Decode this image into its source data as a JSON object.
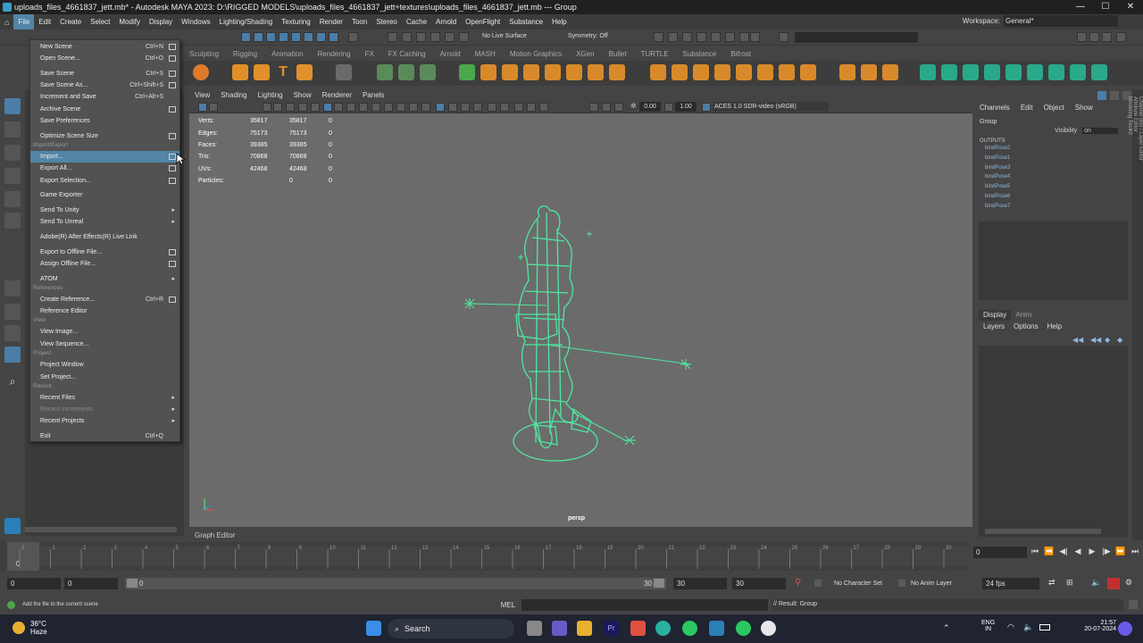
{
  "window": {
    "title": "uploads_files_4661837_jett.mb* - Autodesk MAYA 2023: D:\\RIGGED MODELS\\uploads_files_4661837_jett+textures\\uploads_files_4661837_jett.mb  ---  Group"
  },
  "menubar": {
    "items": [
      "File",
      "Edit",
      "Create",
      "Select",
      "Modify",
      "Display",
      "Windows",
      "Lighting/Shading",
      "Texturing",
      "Render",
      "Toon",
      "Stereo",
      "Cache",
      "Arnold",
      "OpenFlight",
      "Substance",
      "Help"
    ],
    "workspace_label": "Workspace:",
    "workspace_value": "General*"
  },
  "statusline": {
    "live_surface": "No Live Surface",
    "symmetry": "Symmetry: Off"
  },
  "shelf": {
    "tabs": [
      "Sculpting",
      "Rigging",
      "Animation",
      "Rendering",
      "FX",
      "FX Caching",
      "Arnold",
      "MASH",
      "Motion Graphics",
      "XGen",
      "Bullet",
      "TURTLE",
      "Substance",
      "Bifrost"
    ]
  },
  "viewport": {
    "menu": [
      "View",
      "Shading",
      "Lighting",
      "Show",
      "Renderer",
      "Panels"
    ],
    "field_a": "0.00",
    "field_b": "1.00",
    "colorspace": "ACES 1.0 SDR-video (sRGB)",
    "camera": "persp",
    "hud": [
      {
        "label": "Verts:",
        "a": "35817",
        "b": "35817",
        "c": "0"
      },
      {
        "label": "Edges:",
        "a": "75173",
        "b": "75173",
        "c": "0"
      },
      {
        "label": "Faces:",
        "a": "39385",
        "b": "39385",
        "c": "0"
      },
      {
        "label": "Tris:",
        "a": "70868",
        "b": "70868",
        "c": "0"
      },
      {
        "label": "UVs:",
        "a": "42468",
        "b": "42468",
        "c": "0"
      },
      {
        "label": "Particles:",
        "a": "",
        "b": "0",
        "c": "0"
      }
    ]
  },
  "graph_editor_label": "Graph Editor",
  "channel_box": {
    "menu": [
      "Channels",
      "Edit",
      "Object",
      "Show"
    ],
    "object": "Group",
    "visibility_label": "Visibility",
    "visibility_value": "on",
    "outputs_header": "OUTPUTS",
    "outputs": [
      "bindPose2",
      "bindPose1",
      "bindPose3",
      "bindPose4",
      "bindPose5",
      "bindPose6",
      "bindPose7"
    ],
    "layer_tabs": [
      "Display",
      "Anim"
    ],
    "layer_menu": [
      "Layers",
      "Options",
      "Help"
    ]
  },
  "side_tabs": [
    "Channel Box / Layer Editor",
    "Attribute Editor",
    "Modeling Toolkit"
  ],
  "file_menu": {
    "items": [
      {
        "label": "New Scene",
        "shortcut": "Ctrl+N",
        "option": true
      },
      {
        "label": "Open Scene...",
        "shortcut": "Ctrl+O",
        "option": true
      },
      {
        "label": "Save Scene",
        "shortcut": "Ctrl+S",
        "option": true
      },
      {
        "label": "Save Scene As...",
        "shortcut": "Ctrl+Shift+S",
        "option": true
      },
      {
        "label": "Increment and Save",
        "shortcut": "Ctrl+Alt+S",
        "option": false
      },
      {
        "label": "Archive Scene",
        "shortcut": "",
        "option": true
      },
      {
        "label": "Save Preferences",
        "shortcut": "",
        "option": false
      },
      {
        "label": "Optimize Scene Size",
        "shortcut": "",
        "option": true
      },
      {
        "label": "Import...",
        "shortcut": "",
        "option": true
      },
      {
        "label": "Export All...",
        "shortcut": "",
        "option": true
      },
      {
        "label": "Export Selection...",
        "shortcut": "",
        "option": true
      },
      {
        "label": "Game Exporter",
        "shortcut": "",
        "option": false
      },
      {
        "label": "Send To Unity",
        "shortcut": "",
        "option": false
      },
      {
        "label": "Send To Unreal",
        "shortcut": "",
        "option": false
      },
      {
        "label": "Adobe(R) After Effects(R) Live Link",
        "shortcut": "",
        "option": false
      },
      {
        "label": "Export to Offline File...",
        "shortcut": "",
        "option": true
      },
      {
        "label": "Assign Offline File...",
        "shortcut": "",
        "option": true
      },
      {
        "label": "ATOM",
        "shortcut": "",
        "option": false
      },
      {
        "label": "Create Reference...",
        "shortcut": "Ctrl+R",
        "option": true
      },
      {
        "label": "Reference Editor",
        "shortcut": "",
        "option": false
      },
      {
        "label": "View Image...",
        "shortcut": "",
        "option": false
      },
      {
        "label": "View Sequence...",
        "shortcut": "",
        "option": false
      },
      {
        "label": "Project Window",
        "shortcut": "",
        "option": false
      },
      {
        "label": "Set Project...",
        "shortcut": "",
        "option": false
      },
      {
        "label": "Recent Files",
        "shortcut": "",
        "option": false
      },
      {
        "label": "Recent Increments",
        "shortcut": "",
        "option": false
      },
      {
        "label": "Recent Projects",
        "shortcut": "",
        "option": false
      },
      {
        "label": "Exit",
        "shortcut": "Ctrl+Q",
        "option": false
      }
    ],
    "sections": [
      "Import/Export",
      "References",
      "View",
      "Project",
      "Recent"
    ]
  },
  "timeslider": {
    "current": "0",
    "current_frame_field": "0",
    "ticks": [
      "0",
      "1",
      "2",
      "3",
      "4",
      "5",
      "6",
      "7",
      "8",
      "9",
      "10",
      "11",
      "12",
      "13",
      "14",
      "15",
      "16",
      "17",
      "18",
      "19",
      "20",
      "21",
      "22",
      "23",
      "24",
      "25",
      "26",
      "27",
      "28",
      "29",
      "30"
    ]
  },
  "range": {
    "start": "0",
    "anim_start": "0",
    "range_start": "0",
    "range_end": "30",
    "anim_end": "30",
    "end": "30",
    "character_set": "No Character Set",
    "anim_layer": "No Anim Layer",
    "fps": "24 fps"
  },
  "command": {
    "lang": "MEL",
    "result": "// Result: Group",
    "help": "Add the file to the current scene"
  },
  "taskbar": {
    "temp": "36°C",
    "weather": "Haze",
    "search": "Search",
    "lang1": "ENG",
    "lang2": "IN",
    "time": "21:57",
    "date": "20-07-2024"
  },
  "colors": {
    "highlight": "#5285a6",
    "wireframe": "#4ee8a0"
  }
}
